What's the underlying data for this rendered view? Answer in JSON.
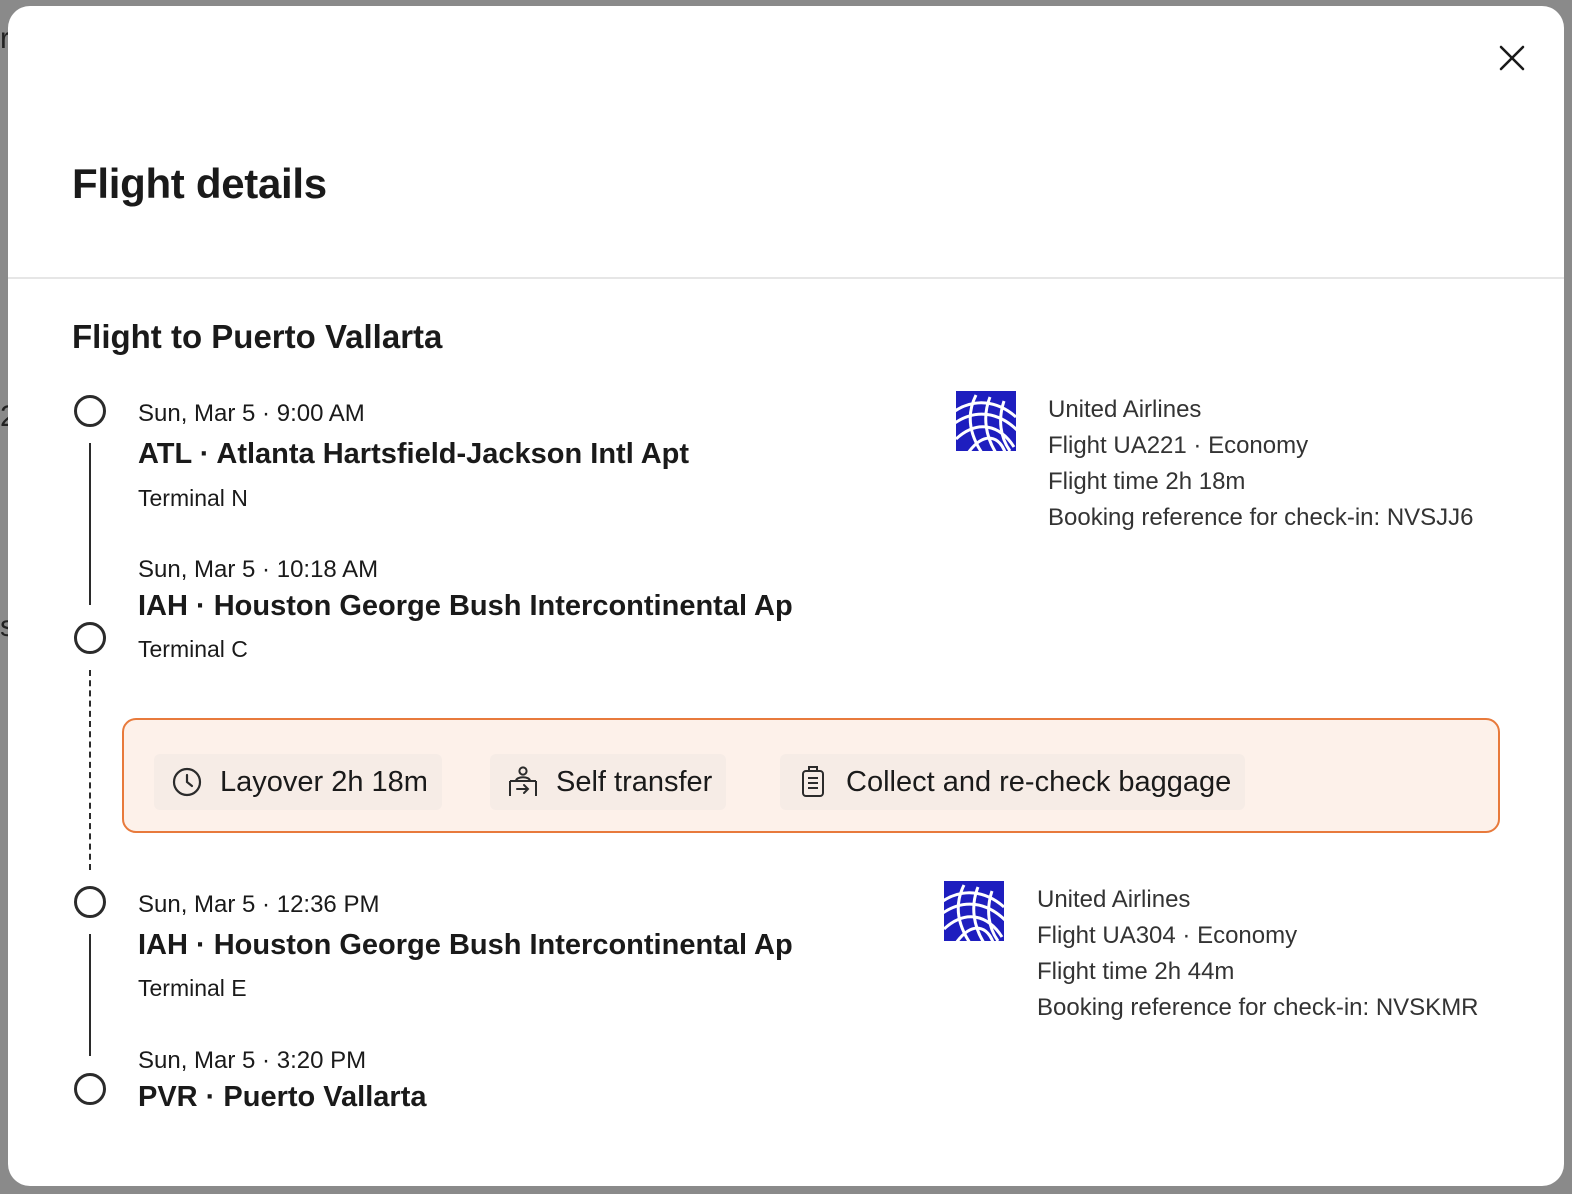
{
  "modal": {
    "title": "Flight details",
    "close_label": "close"
  },
  "trip": {
    "section_title": "Flight to Puerto Vallarta",
    "segments": [
      {
        "departure": {
          "time": "Sun, Mar 5 · 9:00 AM",
          "airport": "ATL · Atlanta Hartsfield-Jackson Intl Apt",
          "terminal": "Terminal N"
        },
        "arrival": {
          "time": "Sun, Mar 5 · 10:18 AM",
          "airport": "IAH · Houston George Bush Intercontinental Ap",
          "terminal": "Terminal C"
        },
        "carrier": {
          "airline": "United Airlines",
          "flight": "Flight UA221 · Economy",
          "duration": "Flight time 2h 18m",
          "booking": "Booking reference for check-in: NVSJJ6",
          "logo_icon": "united-globe-logo"
        }
      },
      {
        "departure": {
          "time": "Sun, Mar 5 · 12:36 PM",
          "airport": "IAH · Houston George Bush Intercontinental Ap",
          "terminal": "Terminal E"
        },
        "arrival": {
          "time": "Sun, Mar 5 · 3:20 PM",
          "airport": "PVR · Puerto Vallarta",
          "terminal": ""
        },
        "carrier": {
          "airline": "United Airlines",
          "flight": "Flight UA304 · Economy",
          "duration": "Flight time 2h 44m",
          "booking": "Booking reference for check-in: NVSKMR",
          "logo_icon": "united-globe-logo"
        }
      }
    ],
    "layover": {
      "duration": "Layover 2h 18m",
      "transfer": "Self transfer",
      "baggage": "Collect and re-check baggage",
      "duration_icon": "clock-icon",
      "transfer_icon": "self-transfer-icon",
      "baggage_icon": "baggage-icon"
    }
  },
  "colors": {
    "layover_border": "#e87a3c",
    "layover_bg": "#fdf1ea",
    "airline_brand": "#1e1ebf"
  }
}
